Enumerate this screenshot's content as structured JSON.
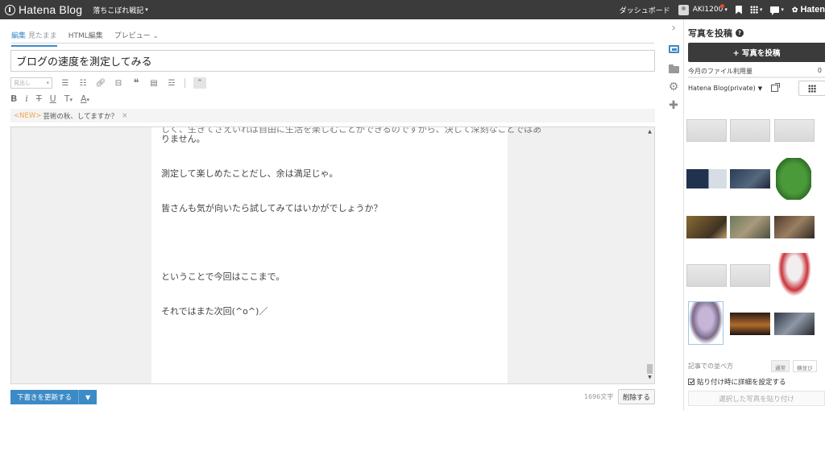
{
  "topbar": {
    "brand": "Hatena Blog",
    "blog_name": "落ちこぼれ戦記",
    "dashboard": "ダッシュボード",
    "user": "AKI1200",
    "brand_right": "Haten"
  },
  "editor": {
    "tabs": {
      "edit_label": "編集",
      "edit_sub": "見たまま",
      "html_label": "HTML編集",
      "preview_label": "プレビュー"
    },
    "title": "ブログの速度を測定してみる",
    "heading_placeholder": "見出し",
    "toolbar_letters": {
      "bold": "B",
      "italic": "i",
      "strike": "T",
      "underline": "U",
      "size": "T",
      "color": "A"
    },
    "suggest": {
      "tag": "<NEW>",
      "text": "芸術の秋、してますか？",
      "close": "×"
    },
    "body_lines": [
      "りません。",
      "測定して楽しめたことだし、余は満足じゃ。",
      "皆さんも気が向いたら試してみてはいかがでしょうか？",
      "ということで今回はここまで。",
      "それではまた次回(^o^)／"
    ],
    "save_label": "下書きを更新する",
    "char_count": "1696文字",
    "delete_label": "削除する"
  },
  "panel": {
    "title": "写真を投稿",
    "post_label": "+ 写真を投稿",
    "usage_label": "今月のファイル利用量",
    "usage_value": "0",
    "album": "Hatena Blog(private)",
    "sort_label": "記事での並べ方",
    "sort_options": [
      "通常",
      "横並び"
    ],
    "detail_label": "貼り付け時に詳細を設定する",
    "paste_label": "選択した写真を貼り付け"
  },
  "colors": {
    "topbar_bg": "#3b3b3b",
    "accent_blue": "#3b8bc6",
    "new_tag_orange": "#f2a44a"
  }
}
